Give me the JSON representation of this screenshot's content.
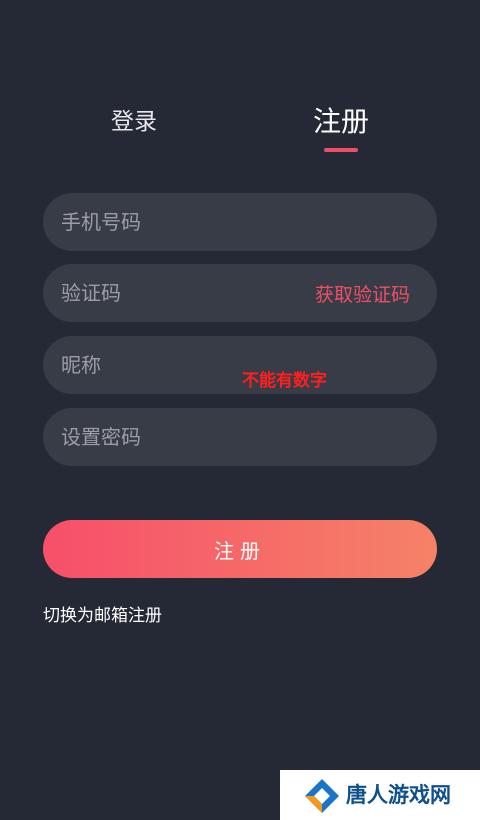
{
  "tabs": {
    "login": "登录",
    "register": "注册"
  },
  "form": {
    "phone_placeholder": "手机号码",
    "code_placeholder": "验证码",
    "get_code_label": "获取验证码",
    "nickname_placeholder": "昵称",
    "nickname_note": "不能有数字",
    "password_placeholder": "设置密码",
    "submit_label": "注册"
  },
  "switch_label": "切换为邮箱注册",
  "watermark": {
    "text": "唐人游戏网"
  },
  "colors": {
    "background": "#252835",
    "field": "#383c46",
    "accent": "#ee4f67",
    "note": "#ff1f1f",
    "gradient_start": "#f74f6a",
    "gradient_end": "#f58267",
    "watermark_text": "#0f4f8b",
    "logo_blue": "#1a74c8",
    "logo_orange": "#f39a1e"
  }
}
